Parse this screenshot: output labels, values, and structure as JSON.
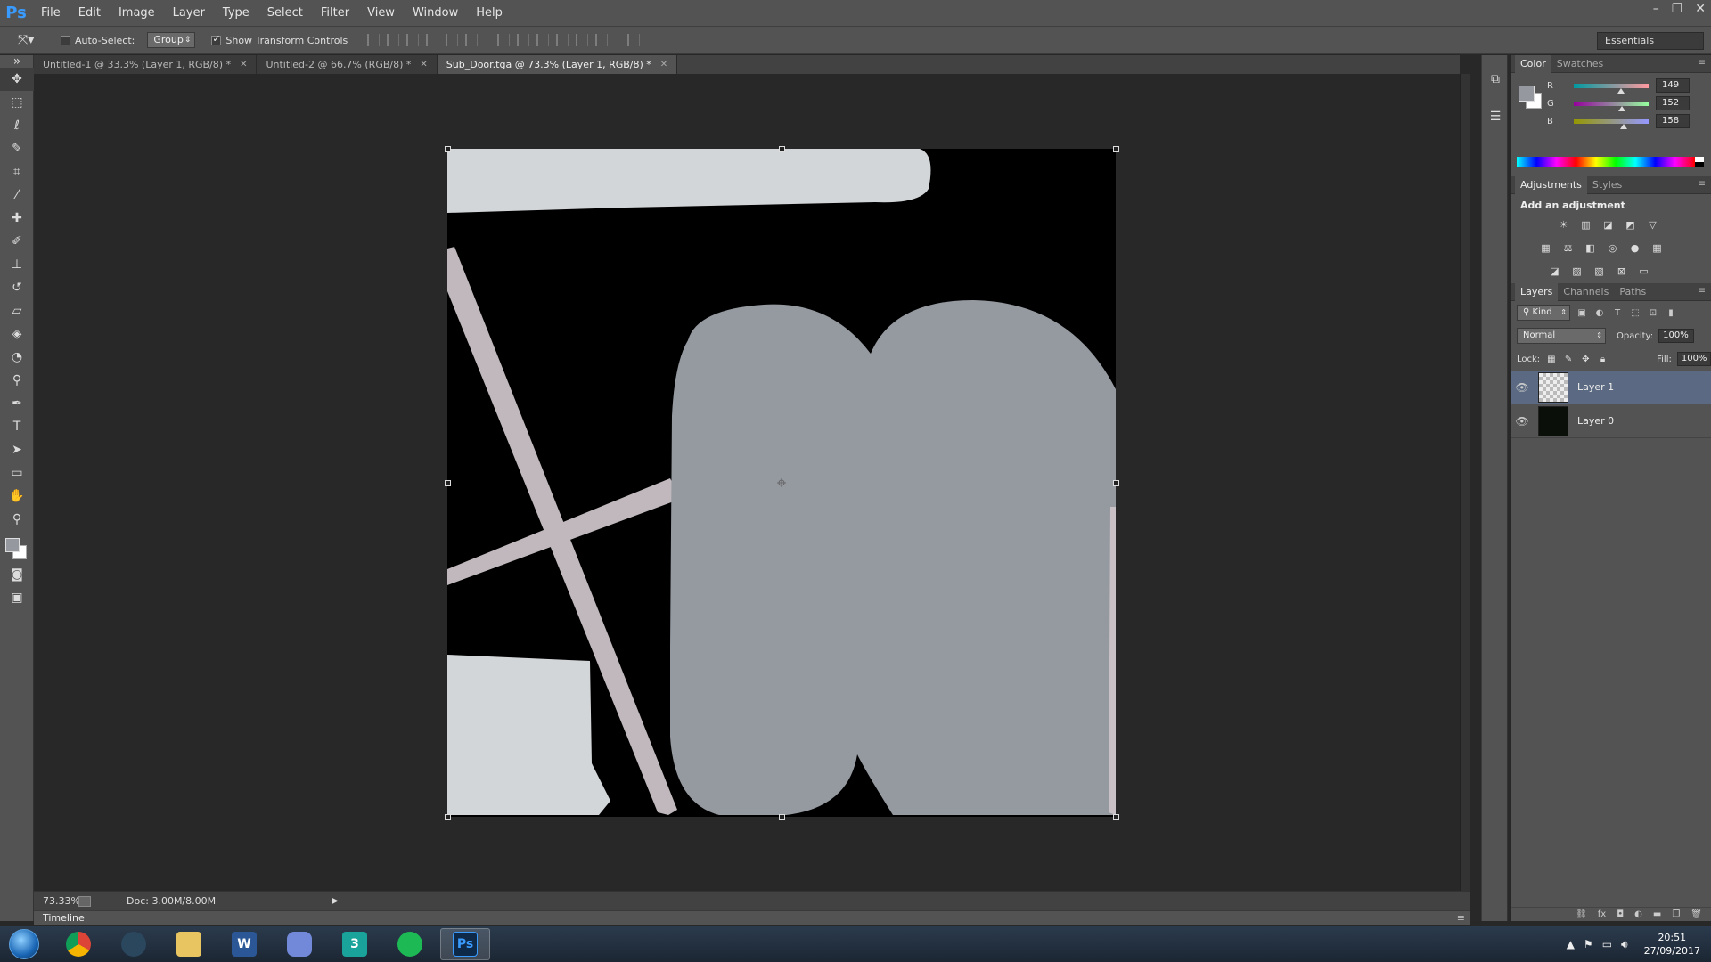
{
  "app": {
    "logo": "Ps",
    "menu": [
      "File",
      "Edit",
      "Image",
      "Layer",
      "Type",
      "Select",
      "Filter",
      "View",
      "Window",
      "Help"
    ],
    "window_controls": [
      "–",
      "❐",
      "✕"
    ]
  },
  "options_bar": {
    "auto_select_label": "Auto-Select:",
    "auto_select_checked": false,
    "auto_select_mode": "Group",
    "show_transform_label": "Show Transform Controls",
    "show_transform_checked": true,
    "workspace": "Essentials"
  },
  "tabs": [
    {
      "label": "Untitled-1 @ 33.3% (Layer 1, RGB/8) *",
      "active": false
    },
    {
      "label": "Untitled-2 @ 66.7% (RGB/8) *",
      "active": false
    },
    {
      "label": "Sub_Door.tga @ 73.3% (Layer 1, RGB/8) *",
      "active": true
    }
  ],
  "status": {
    "zoom": "73.33%",
    "doc_size": "Doc: 3.00M/8.00M"
  },
  "timeline": {
    "label": "Timeline"
  },
  "color_panel": {
    "tabs": [
      "Color",
      "Swatches"
    ],
    "foreground": "#95989e",
    "background": "#ffffff",
    "channels": [
      {
        "label": "R",
        "value": "149",
        "level": 0.584
      },
      {
        "label": "G",
        "value": "152",
        "level": 0.596
      },
      {
        "label": "B",
        "value": "158",
        "level": 0.62
      }
    ]
  },
  "adjustments_panel": {
    "tabs": [
      "Adjustments",
      "Styles"
    ],
    "title": "Add an adjustment",
    "rows": [
      [
        "brightness-icon",
        "levels-icon",
        "curves-icon",
        "exposure-icon",
        "triangle-icon"
      ],
      [
        "vibrance-icon",
        "hue-sat-icon",
        "color-balance-icon",
        "bw-icon",
        "photo-filter-icon",
        "channel-mixer-icon"
      ],
      [
        "invert-icon",
        "posterize-icon",
        "threshold-icon",
        "selective-color-icon",
        "gradient-map-icon"
      ]
    ]
  },
  "layers_panel": {
    "tabs": [
      "Layers",
      "Channels",
      "Paths"
    ],
    "kind_label": "Kind",
    "blend_mode": "Normal",
    "opacity_label": "Opacity:",
    "opacity": "100%",
    "lock_label": "Lock:",
    "fill_label": "Fill:",
    "fill": "100%",
    "layers": [
      {
        "name": "Layer 1",
        "selected": true
      },
      {
        "name": "Layer 0",
        "selected": false
      }
    ]
  },
  "taskbar": {
    "apps": [
      {
        "name": "chrome",
        "label": "",
        "color": "#e8b23a",
        "active": false
      },
      {
        "name": "steam",
        "label": "",
        "color": "#2a475e",
        "active": false
      },
      {
        "name": "explorer",
        "label": "",
        "color": "#e8c560",
        "active": false
      },
      {
        "name": "word",
        "label": "W",
        "color": "#2b5797",
        "active": false
      },
      {
        "name": "discord",
        "label": "",
        "color": "#7289da",
        "active": false
      },
      {
        "name": "3dsmax",
        "label": "3",
        "color": "#1aa39a",
        "active": false
      },
      {
        "name": "spotify",
        "label": "",
        "color": "#1db954",
        "active": false
      },
      {
        "name": "photoshop",
        "label": "Ps",
        "color": "#0f2a48",
        "active": true
      }
    ],
    "time": "20:51",
    "date": "27/09/2017"
  }
}
